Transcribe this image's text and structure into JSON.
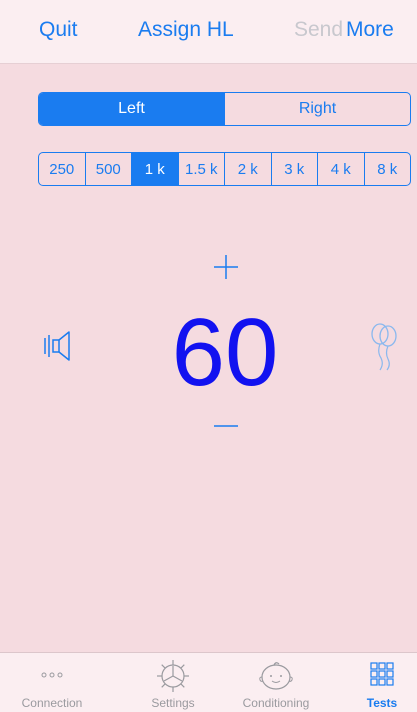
{
  "navbar": {
    "quit_label": "Quit",
    "title": "Assign HL",
    "send_label": "Send",
    "more_label": "More"
  },
  "ear_selector": {
    "options": [
      "Left",
      "Right"
    ],
    "selected": "Left"
  },
  "frequency_selector": {
    "options": [
      "250",
      "500",
      "1 k",
      "1.5 k",
      "2 k",
      "3 k",
      "4 k",
      "8 k"
    ],
    "selected": "1 k"
  },
  "level": {
    "value": "60",
    "increase_symbol": "+",
    "decrease_symbol": "—"
  },
  "icons": {
    "left": "speaker-icon",
    "right": "balloon-icon"
  },
  "tabbar": {
    "tabs": [
      {
        "label": "Connection",
        "icon": "dots-icon"
      },
      {
        "label": "Settings",
        "icon": "gear-icon"
      },
      {
        "label": "Conditioning",
        "icon": "baby-face-icon"
      },
      {
        "label": "Tests",
        "icon": "grid-icon"
      }
    ],
    "selected": "Tests"
  },
  "colors": {
    "accent": "#1a7cf0",
    "level_text": "#1212f0",
    "background": "#f5dbe0",
    "disabled": "#c8c8ce",
    "inactive_tab": "#9a9a9f"
  }
}
